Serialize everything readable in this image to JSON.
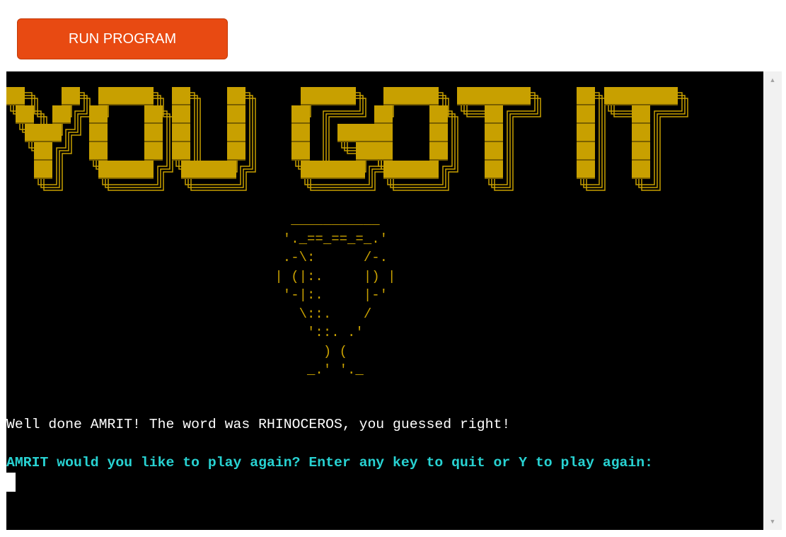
{
  "toolbar": {
    "run_label": "RUN PROGRAM"
  },
  "terminal": {
    "banner_text": "YOU GOT IT",
    "trophy_art": "   ___________\n  '._==_==_=_.'\n  .-\\:      /-.\n | (|:.     |) |\n  '-|:.     |-'\n    \\::.    /\n     '::. .'\n       ) (\n     _.' '._",
    "message": "Well done AMRIT! The word was RHINOCEROS, you guessed right!",
    "prompt": "AMRIT would you like to play again? Enter any key to quit or Y to play again:"
  },
  "colors": {
    "button_bg": "#e84a12",
    "terminal_bg": "#000000",
    "banner": "#c8a000",
    "prompt": "#28d2d2",
    "message": "#ffffff"
  },
  "icons": {
    "scroll_up": "triangle-up-icon",
    "scroll_down": "triangle-down-icon"
  }
}
